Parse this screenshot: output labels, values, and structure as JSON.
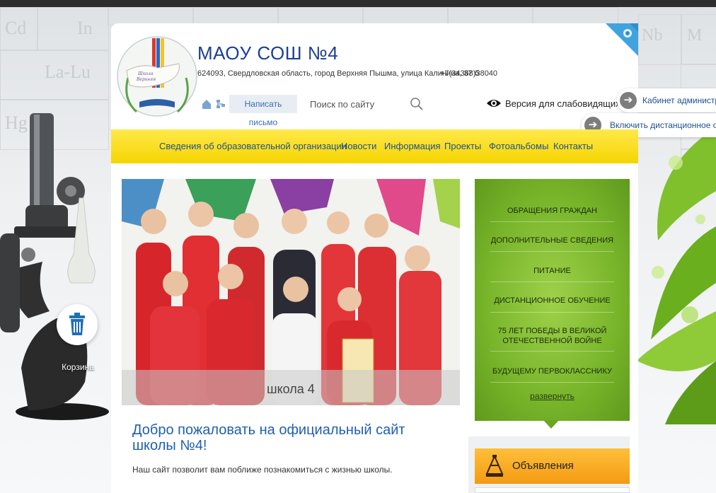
{
  "header": {
    "school_name": "МАОУ СОШ №4",
    "address": "624093, Свердловская область, город Верхняя Пышма, улица Калинина, 37 б",
    "phone": "+7(34368)38040",
    "write_letter": "Написать письмо",
    "search_placeholder": "Поиск по сайту",
    "low_vision": "Версия для слабовидящих"
  },
  "side_tabs": {
    "admin_cabinet": "Кабинет администратора",
    "enable_remote": "Включить дистанционное обучение"
  },
  "nav": {
    "items": [
      "Сведения об образовательной организации",
      "Новости",
      "Информация",
      "Проекты",
      "Фотоальбомы",
      "Контакты"
    ]
  },
  "slider": {
    "caption": "школа 4"
  },
  "welcome": {
    "title": "Добро пожаловать на официальный сайт школы №4!",
    "text": "Наш сайт позволит вам поближе познакомиться с жизнью  школы."
  },
  "side_menu": {
    "items": [
      "ОБРАЩЕНИЯ ГРАЖДАН",
      "ДОПОЛНИТЕЛЬНЫЕ СВЕДЕНИЯ",
      "ПИТАНИЕ",
      "ДИСТАНЦИОННОЕ ОБУЧЕНИЕ",
      "75 ЛЕТ ПОБЕДЫ В ВЕЛИКОЙ ОТЕЧЕСТВЕННОЙ ВОЙНЕ",
      "БУДУЩЕМУ ПЕРВОКЛАССНИКУ"
    ],
    "expand": "развернуть"
  },
  "announcements": {
    "title": "Объявления"
  },
  "cart": {
    "label": "Корзина"
  },
  "colors": {
    "brand_blue": "#1b3f93",
    "nav_yellow": "#f5d400",
    "menu_green": "#78b52a",
    "announce_orange": "#f49a12"
  }
}
